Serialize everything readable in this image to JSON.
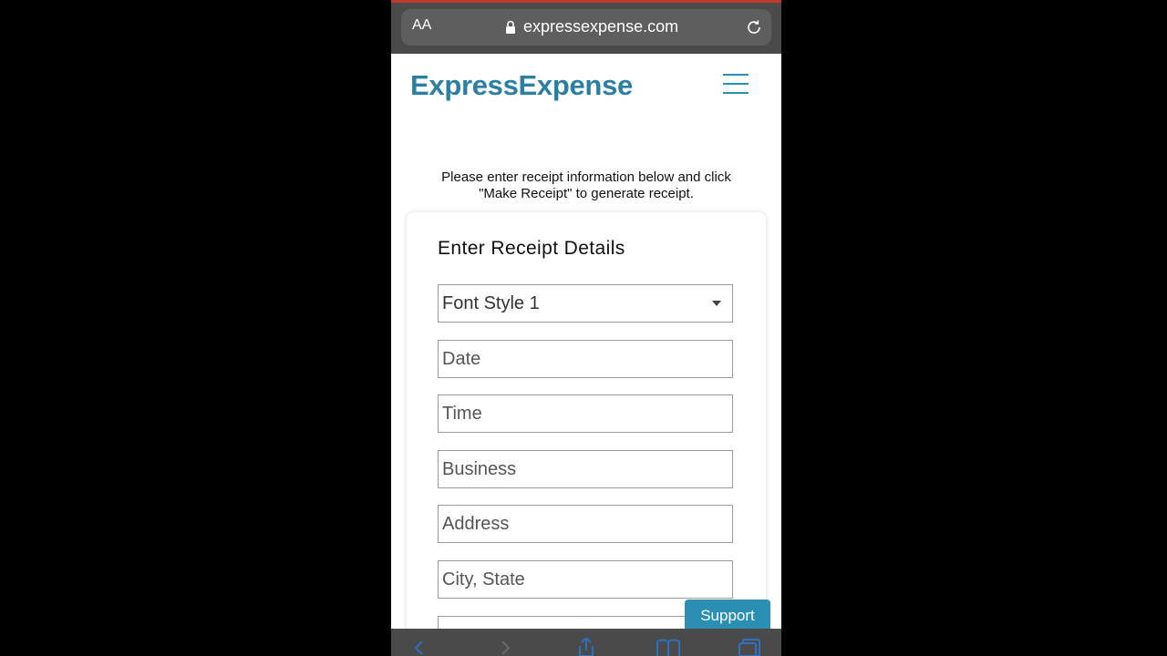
{
  "browser": {
    "text_size_label": "AA",
    "url": "expressexpense.com"
  },
  "site": {
    "logo": "ExpressExpense"
  },
  "main": {
    "intro_line1": "Please enter receipt information below and click",
    "intro_line2": "\"Make Receipt\" to generate receipt.",
    "card_title": "Enter Receipt Details",
    "font_style_select": "Font Style 1",
    "fields": {
      "date": "Date",
      "time": "Time",
      "business": "Business",
      "address": "Address",
      "city_state": "City, State"
    }
  },
  "support_label": "Support",
  "colors": {
    "brand": "#2a7fa3",
    "accent": "#2a8fb3",
    "browser_chrome": "#4a4a4a",
    "toolbar_icon": "#2f6fbf"
  }
}
